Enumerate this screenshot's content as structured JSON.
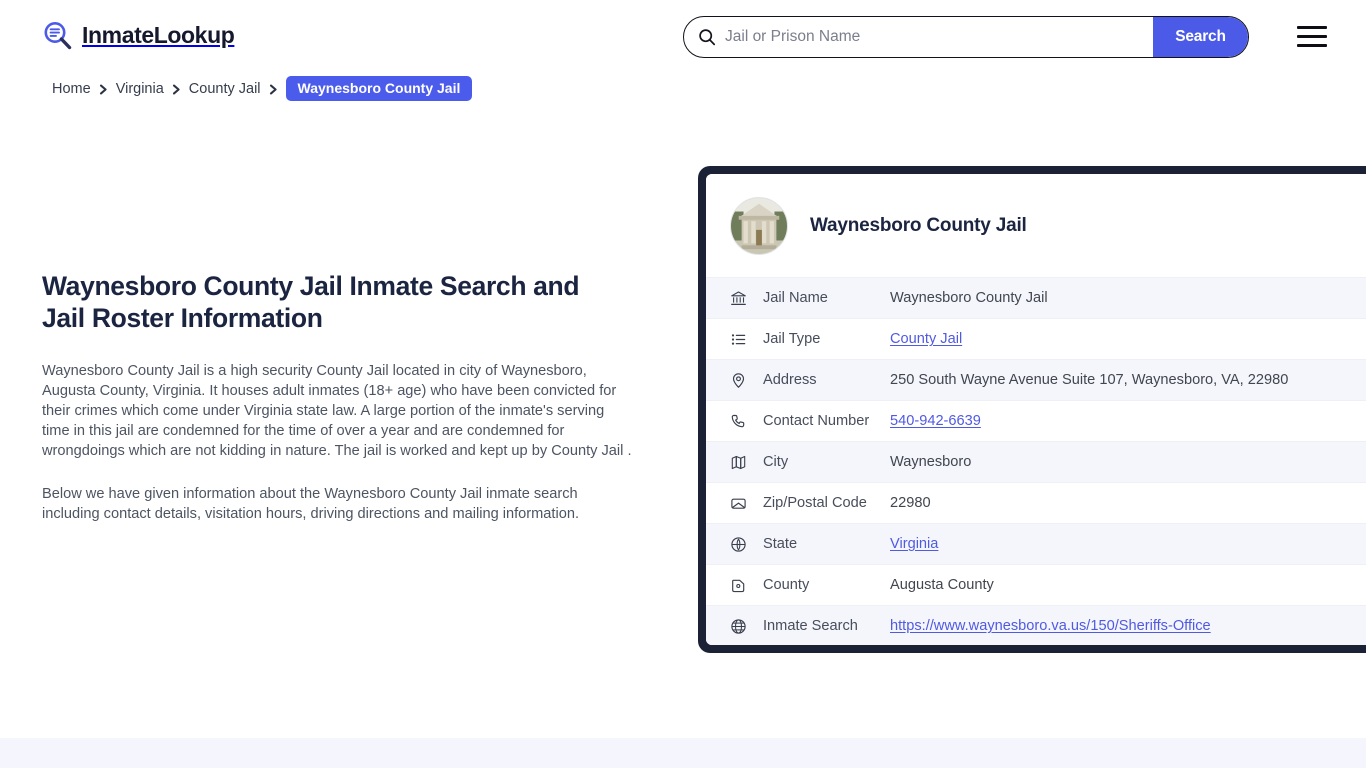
{
  "header": {
    "logo_text": "InmateLookup",
    "logo_icon": "magnifier-list-icon",
    "menu_icon": "hamburger-menu-icon"
  },
  "search": {
    "icon": "search-icon",
    "placeholder": "Jail or Prison Name",
    "value": "",
    "button_label": "Search"
  },
  "breadcrumb": {
    "items": [
      {
        "label": "Home",
        "current": false
      },
      {
        "label": "Virginia",
        "current": false
      },
      {
        "label": "County Jail",
        "current": false
      },
      {
        "label": "Waynesboro County Jail",
        "current": true
      }
    ]
  },
  "main": {
    "title": "Waynesboro County Jail Inmate Search and Jail Roster Information",
    "paragraph_1": "Waynesboro County Jail is a high security County Jail located in city of Waynesboro, Augusta County, Virginia. It houses adult inmates (18+ age) who have been convicted for their crimes which come under Virginia state law. A large portion of the inmate's serving time in this jail are condemned for the time of over a year and are condemned for wrongdoings which are not kidding in nature. The jail is worked and kept up by County Jail .",
    "paragraph_2": "Below we have given information about the Waynesboro County Jail inmate search including contact details, visitation hours, driving directions and mailing information."
  },
  "info_card": {
    "avatar_icon": "courthouse-photo",
    "title": "Waynesboro County Jail",
    "rows": [
      {
        "icon": "bank-icon",
        "label": "Jail Name",
        "value": "Waynesboro County Jail",
        "link": false
      },
      {
        "icon": "list-icon",
        "label": "Jail Type",
        "value": "County Jail",
        "link": true
      },
      {
        "icon": "map-pin-icon",
        "label": "Address",
        "value": "250 South Wayne Avenue Suite 107, Waynesboro, VA, 22980",
        "link": false
      },
      {
        "icon": "phone-icon",
        "label": "Contact Number",
        "value": "540-942-6639",
        "link": true
      },
      {
        "icon": "map-icon",
        "label": "City",
        "value": "Waynesboro",
        "link": false
      },
      {
        "icon": "envelope-icon",
        "label": "Zip/Postal Code",
        "value": "22980",
        "link": false
      },
      {
        "icon": "compass-icon",
        "label": "State",
        "value": "Virginia",
        "link": true
      },
      {
        "icon": "county-map-icon",
        "label": "County",
        "value": "Augusta County",
        "link": false
      },
      {
        "icon": "globe-icon",
        "label": "Inmate Search",
        "value": "https://www.waynesboro.va.us/150/Sheriffs-Office",
        "link": true
      }
    ]
  },
  "colors": {
    "accent_blue": "#4b5be8",
    "badge_blue": "#4b5beb",
    "link_blue": "#4f5ae2",
    "card_border_navy": "#1b2236",
    "heading_navy": "#1b2440",
    "row_alt": "#f5f6fc",
    "footer_strip": "#f5f6fd"
  }
}
